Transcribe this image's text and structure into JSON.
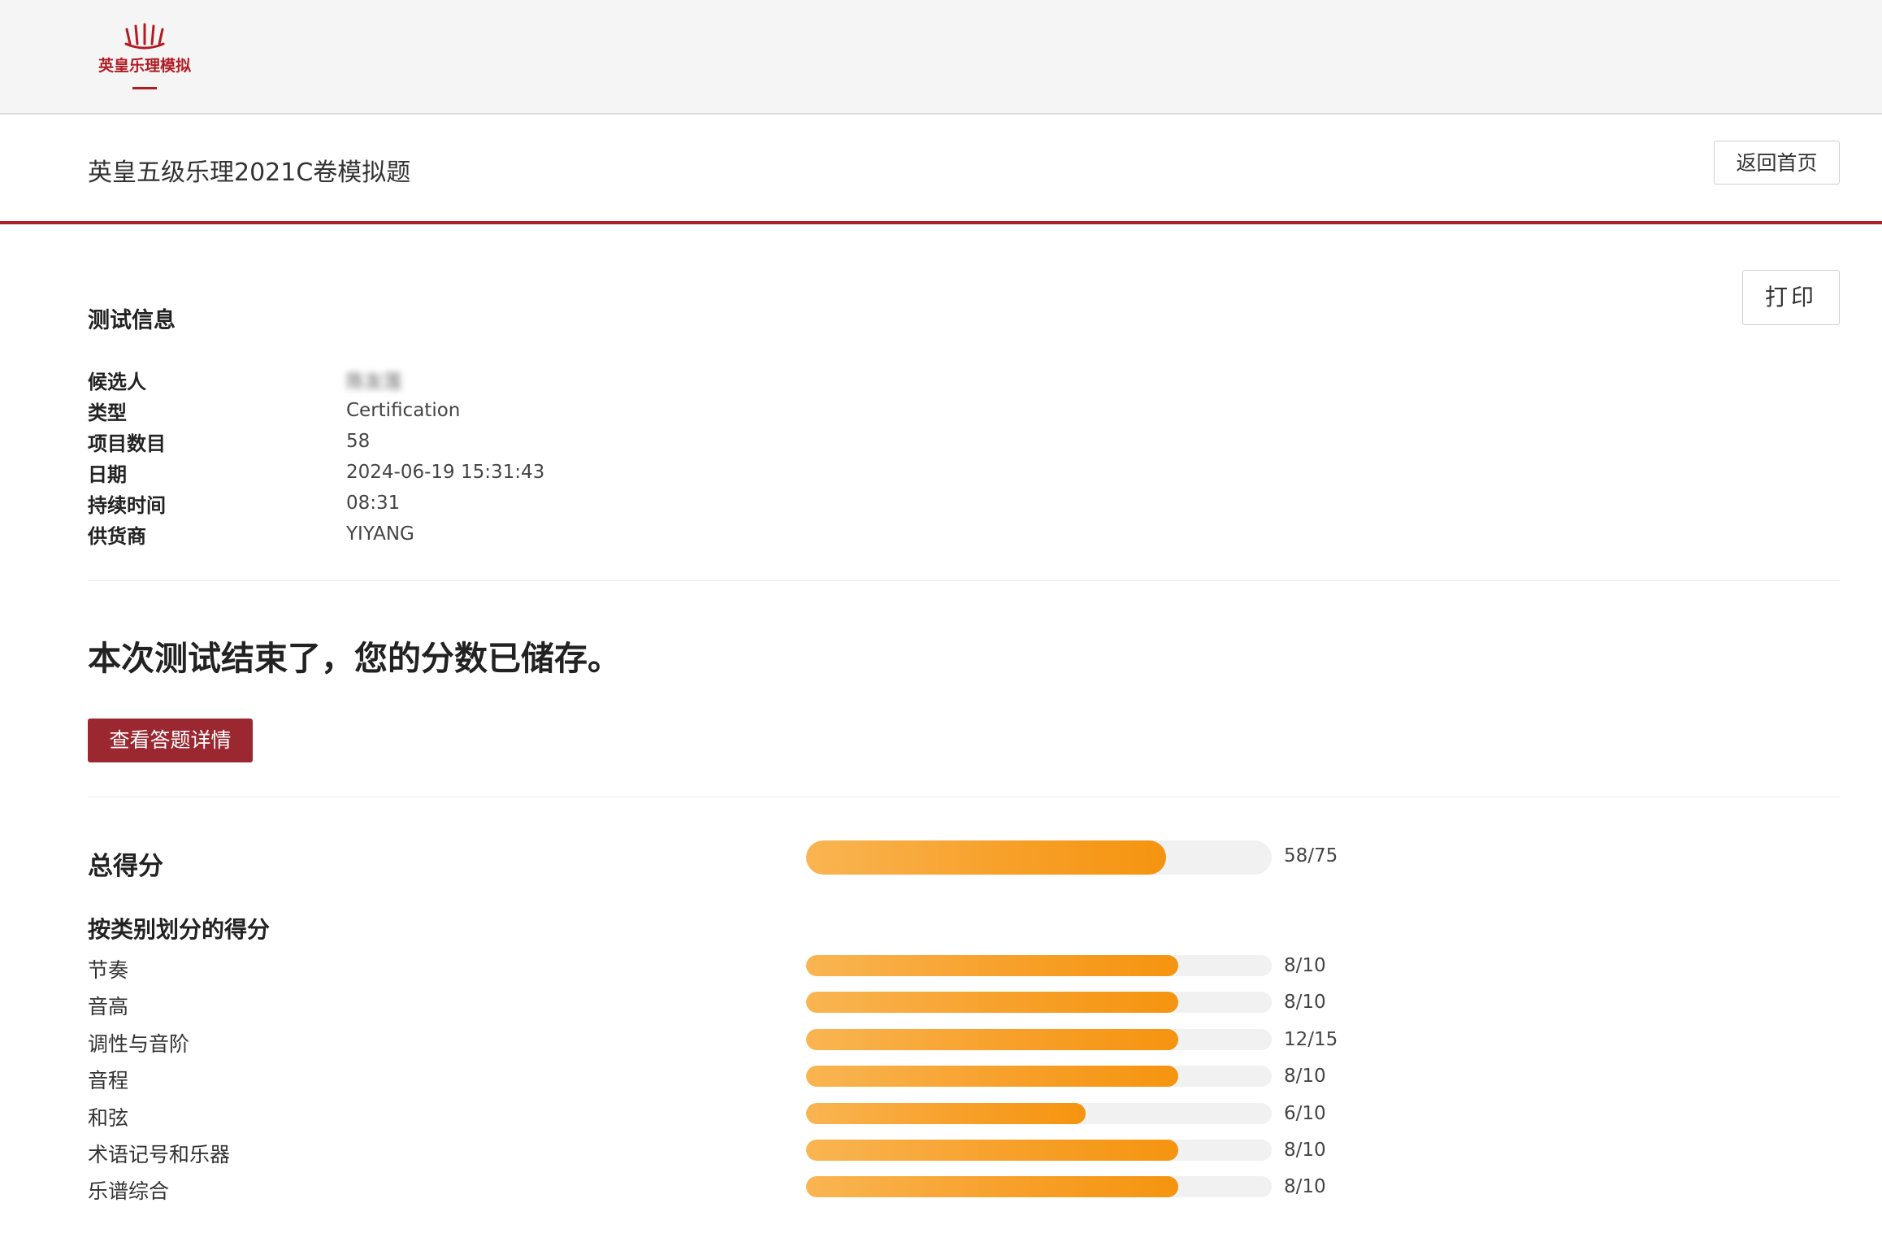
{
  "header": {
    "logo_text": "英皇乐理模拟",
    "exam_title": "英皇五级乐理2021C卷模拟题",
    "home_button": "返回首页",
    "print_button": "打印"
  },
  "test_info": {
    "section_title": "测试信息",
    "rows": [
      {
        "label": "候选人",
        "value": "陈友莲"
      },
      {
        "label": "类型",
        "value": "Certification"
      },
      {
        "label": "项目数目",
        "value": "58"
      },
      {
        "label": "日期",
        "value": "2024-06-19 15:31:43"
      },
      {
        "label": "持续时间",
        "value": "08:31"
      },
      {
        "label": "供货商",
        "value": "YIYANG"
      }
    ]
  },
  "result": {
    "message": "本次测试结束了，您的分数已储存。",
    "details_button": "查看答题详情"
  },
  "scores": {
    "total_label": "总得分",
    "total": {
      "score": 58,
      "max": 75,
      "text": "58/75"
    },
    "category_title": "按类别划分的得分",
    "categories": [
      {
        "label": "节奏",
        "score": 8,
        "max": 10,
        "text": "8/10"
      },
      {
        "label": "音高",
        "score": 8,
        "max": 10,
        "text": "8/10"
      },
      {
        "label": "调性与音阶",
        "score": 12,
        "max": 15,
        "text": "12/15"
      },
      {
        "label": "音程",
        "score": 8,
        "max": 10,
        "text": "8/10"
      },
      {
        "label": "和弦",
        "score": 6,
        "max": 10,
        "text": "6/10"
      },
      {
        "label": "术语记号和乐器",
        "score": 8,
        "max": 10,
        "text": "8/10"
      },
      {
        "label": "乐谱综合",
        "score": 8,
        "max": 10,
        "text": "8/10"
      }
    ]
  },
  "colors": {
    "brand_red": "#b01c24",
    "button_red": "#9b2730",
    "bar_orange": "#f7a02a",
    "track_grey": "#f1f1f1"
  }
}
